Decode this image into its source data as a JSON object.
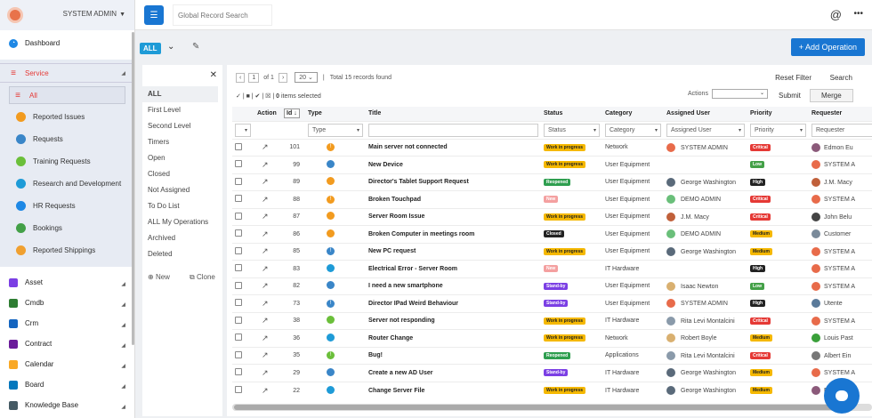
{
  "sidebar": {
    "user": "SYSTEM ADMIN",
    "dashboard": "Dashboard",
    "service": "Service",
    "all": "All",
    "service_items": [
      {
        "label": "Reported Issues",
        "color": "#f29b1f"
      },
      {
        "label": "Requests",
        "color": "#3a86c8"
      },
      {
        "label": "Training Requests",
        "color": "#6bbf3a"
      },
      {
        "label": "Research and Development",
        "color": "#1e9bd7"
      },
      {
        "label": "HR Requests",
        "color": "#1e88e5"
      },
      {
        "label": "Bookings",
        "color": "#43a047"
      },
      {
        "label": "Reported Shippings",
        "color": "#f0a030"
      }
    ],
    "modules": [
      {
        "label": "Asset",
        "color": "#7b3fe4"
      },
      {
        "label": "Cmdb",
        "color": "#2e7d32"
      },
      {
        "label": "Crm",
        "color": "#1565c0"
      },
      {
        "label": "Contract",
        "color": "#6a1b9a"
      },
      {
        "label": "Calendar",
        "color": "#f9a825"
      },
      {
        "label": "Board",
        "color": "#0277bd"
      },
      {
        "label": "Knowledge Base",
        "color": "#455a64"
      }
    ]
  },
  "topbar": {
    "search_placeholder": "Global Record Search",
    "at": "@",
    "more": "•••"
  },
  "toolbar": {
    "all_tag": "ALL",
    "add_operation": "+ Add Operation"
  },
  "filters": {
    "items": [
      "ALL",
      "First Level",
      "Second Level",
      "Timers",
      "Open",
      "Closed",
      "Not Assigned",
      "To Do List",
      "ALL My Operations",
      "Archived",
      "Deleted"
    ],
    "new": "New",
    "clone": "Clone"
  },
  "grid": {
    "page": "1",
    "of": "of 1",
    "per_page": "20",
    "total": "Total 15 records found",
    "reset": "Reset Filter",
    "search": "Search",
    "selected": "0",
    "selected_label": "items selected",
    "actions_label": "Actions",
    "submit": "Submit",
    "merge": "Merge",
    "headers": {
      "action": "Action",
      "id": "Id",
      "type": "Type",
      "title": "Title",
      "status": "Status",
      "category": "Category",
      "assigned": "Assigned User",
      "priority": "Priority",
      "requester": "Requester"
    },
    "filter_placeholders": {
      "type": "Type",
      "status": "Status",
      "category": "Category",
      "assigned": "Assigned User",
      "priority": "Priority",
      "requester": "Requester"
    },
    "rows": [
      {
        "id": "101",
        "type_color": "#f29b1f",
        "title": "Main server not connected",
        "status": "Work in progress",
        "status_color": "#f5b800",
        "category": "Network",
        "assigned": "SYSTEM ADMIN",
        "avatar_color": "#e86b4a",
        "priority": "Critical",
        "priority_color": "#e53935",
        "requester": "Edmon Eu",
        "req_color": "#8b5a7a"
      },
      {
        "id": "99",
        "type_color": "#3a86c8",
        "title": "New Device",
        "status": "Work in progress",
        "status_color": "#f5b800",
        "category": "User Equipment",
        "assigned": "",
        "avatar_color": "",
        "priority": "Low",
        "priority_color": "#43a047",
        "requester": "SYSTEM A",
        "req_color": "#e86b4a"
      },
      {
        "id": "89",
        "type_color": "#f29b1f",
        "title": "Director's Tablet Support Request",
        "status": "Reopened",
        "status_color": "#2e9e4f",
        "category": "User Equipment",
        "assigned": "George Washington",
        "avatar_color": "#5a6a7a",
        "priority": "High",
        "priority_color": "#222",
        "requester": "J.M. Macy",
        "req_color": "#c0603a"
      },
      {
        "id": "88",
        "type_color": "#f29b1f",
        "title": "Broken Touchpad",
        "status": "New",
        "status_color": "#f4a0a0",
        "category": "User Equipment",
        "assigned": "DEMO ADMIN",
        "avatar_color": "#6abf7a",
        "priority": "Critical",
        "priority_color": "#e53935",
        "requester": "SYSTEM A",
        "req_color": "#e86b4a"
      },
      {
        "id": "87",
        "type_color": "#f29b1f",
        "title": "Server Room Issue",
        "status": "Work in progress",
        "status_color": "#f5b800",
        "category": "User Equipment",
        "assigned": "J.M. Macy",
        "avatar_color": "#c0603a",
        "priority": "Critical",
        "priority_color": "#e53935",
        "requester": "John Belu",
        "req_color": "#444"
      },
      {
        "id": "86",
        "type_color": "#f29b1f",
        "title": "Broken Computer in meetings room",
        "status": "Closed",
        "status_color": "#222",
        "category": "User Equipment",
        "assigned": "DEMO ADMIN",
        "avatar_color": "#6abf7a",
        "priority": "Medium",
        "priority_color": "#f5b800",
        "requester": "Customer",
        "req_color": "#7a8a9a"
      },
      {
        "id": "85",
        "type_color": "#3a86c8",
        "title": "New PC request",
        "status": "Work in progress",
        "status_color": "#f5b800",
        "category": "User Equipment",
        "assigned": "George Washington",
        "avatar_color": "#5a6a7a",
        "priority": "Medium",
        "priority_color": "#f5b800",
        "requester": "SYSTEM A",
        "req_color": "#e86b4a"
      },
      {
        "id": "83",
        "type_color": "#1e9bd7",
        "title": "Electrical Error - Server Room",
        "status": "New",
        "status_color": "#f4a0a0",
        "category": "IT Hardware",
        "assigned": "",
        "avatar_color": "",
        "priority": "High",
        "priority_color": "#222",
        "requester": "SYSTEM A",
        "req_color": "#e86b4a"
      },
      {
        "id": "82",
        "type_color": "#3a86c8",
        "title": "I need a new smartphone",
        "status": "Stand-by",
        "status_color": "#7b3fe4",
        "category": "User Equipment",
        "assigned": "Isaac Newton",
        "avatar_color": "#d9b070",
        "priority": "Low",
        "priority_color": "#43a047",
        "requester": "SYSTEM A",
        "req_color": "#e86b4a"
      },
      {
        "id": "73",
        "type_color": "#3a86c8",
        "title": "Director IPad Weird Behaviour",
        "status": "Stand-by",
        "status_color": "#7b3fe4",
        "category": "User Equipment",
        "assigned": "SYSTEM ADMIN",
        "avatar_color": "#e86b4a",
        "priority": "High",
        "priority_color": "#222",
        "requester": "Utente",
        "req_color": "#5a7a9a"
      },
      {
        "id": "38",
        "type_color": "#6bbf3a",
        "title": "Server not responding",
        "status": "Work in progress",
        "status_color": "#f5b800",
        "category": "IT Hardware",
        "assigned": "Rita Levi Montalcini",
        "avatar_color": "#8a9aaa",
        "priority": "Critical",
        "priority_color": "#e53935",
        "requester": "SYSTEM A",
        "req_color": "#e86b4a"
      },
      {
        "id": "36",
        "type_color": "#1e9bd7",
        "title": "Router Change",
        "status": "Work in progress",
        "status_color": "#f5b800",
        "category": "Network",
        "assigned": "Robert Boyle",
        "avatar_color": "#d9b070",
        "priority": "Medium",
        "priority_color": "#f5b800",
        "requester": "Louis Past",
        "req_color": "#3aa03a"
      },
      {
        "id": "35",
        "type_color": "#6bbf3a",
        "title": "Bug!",
        "status": "Reopened",
        "status_color": "#2e9e4f",
        "category": "Applications",
        "assigned": "Rita Levi Montalcini",
        "avatar_color": "#8a9aaa",
        "priority": "Critical",
        "priority_color": "#e53935",
        "requester": "Albert Ein",
        "req_color": "#777"
      },
      {
        "id": "29",
        "type_color": "#3a86c8",
        "title": "Create a new AD User",
        "status": "Stand-by",
        "status_color": "#7b3fe4",
        "category": "IT Hardware",
        "assigned": "George Washington",
        "avatar_color": "#5a6a7a",
        "priority": "Medium",
        "priority_color": "#f5b800",
        "requester": "SYSTEM A",
        "req_color": "#e86b4a"
      },
      {
        "id": "22",
        "type_color": "#1e9bd7",
        "title": "Change Server File",
        "status": "Work in progress",
        "status_color": "#f5b800",
        "category": "IT Hardware",
        "assigned": "George Washington",
        "avatar_color": "#5a6a7a",
        "priority": "Medium",
        "priority_color": "#f5b800",
        "requester": "Edmon Eu",
        "req_color": "#8b5a7a"
      }
    ]
  }
}
